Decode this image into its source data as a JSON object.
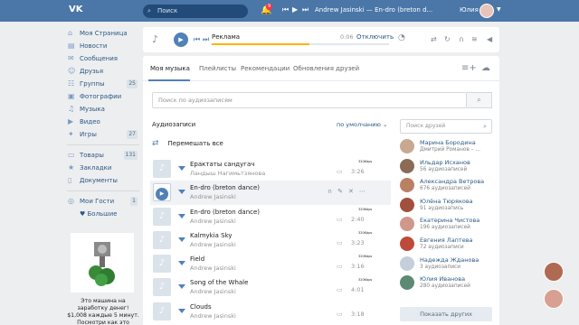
{
  "topbar": {
    "logo": "VK",
    "search_placeholder": "Поиск",
    "notification_count": "9",
    "now_playing": "Andrew Jasinski — En-dro (breton d...",
    "user_name": "Юлия"
  },
  "nav": {
    "items": [
      {
        "label": "Моя Страница",
        "icon": "home-icon",
        "count": ""
      },
      {
        "label": "Новости",
        "icon": "news-icon",
        "count": ""
      },
      {
        "label": "Сообщения",
        "icon": "messages-icon",
        "count": ""
      },
      {
        "label": "Друзья",
        "icon": "friends-icon",
        "count": ""
      },
      {
        "label": "Группы",
        "icon": "groups-icon",
        "count": "25"
      },
      {
        "label": "Фотографии",
        "icon": "photos-icon",
        "count": ""
      },
      {
        "label": "Музыка",
        "icon": "music-icon",
        "count": ""
      },
      {
        "label": "Видео",
        "icon": "video-icon",
        "count": ""
      },
      {
        "label": "Игры",
        "icon": "games-icon",
        "count": "27"
      }
    ],
    "items2": [
      {
        "label": "Товары",
        "icon": "goods-icon",
        "count": "131"
      },
      {
        "label": "Закладки",
        "icon": "bookmarks-icon",
        "count": ""
      },
      {
        "label": "Документы",
        "icon": "documents-icon",
        "count": ""
      }
    ],
    "items3": [
      {
        "label": "Мои Гости",
        "icon": "guests-icon",
        "count": "1"
      },
      {
        "label": "♥ Большие",
        "icon": "heart-icon",
        "count": ""
      }
    ],
    "ad_text": "Это машина на заработку денег! $1,008 каждые 5 минут. Посмотри как это"
  },
  "player": {
    "title": "Реклама",
    "elapsed": "0:06",
    "off_label": "Отключить",
    "progress": 0.55
  },
  "tabs": {
    "my_music": "Моя музыка",
    "playlists": "Плейлисты",
    "recommendations": "Рекомендации",
    "friends_updates": "Обновления друзей"
  },
  "audio": {
    "search_placeholder": "Поиск по аудиозаписям",
    "heading": "Аудиозаписи",
    "sort": "по умолчанию",
    "shuffle": "Перемешать все",
    "tracks": [
      {
        "title": "Ерактаты сандугач",
        "artist": "Ландыш Нагимьтзянова",
        "kbps": "320Kbps",
        "duration": "3:26"
      },
      {
        "title": "En-dro (breton dance)",
        "artist": "Andrew Jasinski",
        "kbps": "",
        "duration": ""
      },
      {
        "title": "En-dro (breton dance)",
        "artist": "Andrew Jasinski",
        "kbps": "320Kbps",
        "duration": "2:40"
      },
      {
        "title": "Kalmykia Sky",
        "artist": "Andrew Jasinski",
        "kbps": "320Kbps",
        "duration": "3:23"
      },
      {
        "title": "Field",
        "artist": "Andrew Jasinski",
        "kbps": "320Kbps",
        "duration": "3:16"
      },
      {
        "title": "Song of the Whale",
        "artist": "Andrew Jasinski",
        "kbps": "320Kbps",
        "duration": "4:01"
      },
      {
        "title": "Clouds",
        "artist": "Andrew Jasinski",
        "kbps": "",
        "duration": "3:18"
      }
    ]
  },
  "friends": {
    "search_placeholder": "Поиск друзей",
    "list": [
      {
        "name": "Марина Бородина",
        "sub": "Дмитрий Романов – ...",
        "color": "#c9a88f"
      },
      {
        "name": "Ильдар Исханов",
        "sub": "56 аудиозаписей",
        "color": "#8a6b55"
      },
      {
        "name": "Александра Ветрова",
        "sub": "676 аудиозаписей",
        "color": "#b98064"
      },
      {
        "name": "Юлёна Тюрякова",
        "sub": "91 аудиозапись",
        "color": "#a0503c"
      },
      {
        "name": "Екатерина Чистова",
        "sub": "196 аудиозаписей",
        "color": "#d0988a"
      },
      {
        "name": "Евгения Лаптева",
        "sub": "72 аудиозаписи",
        "color": "#c04a3a"
      },
      {
        "name": "Надежда Жданова",
        "sub": "3 аудиозаписи",
        "color": "#c5cfda"
      },
      {
        "name": "Юлия Иванова",
        "sub": "280 аудиозаписей",
        "color": "#5d8a74"
      }
    ],
    "more": "Показать других"
  }
}
